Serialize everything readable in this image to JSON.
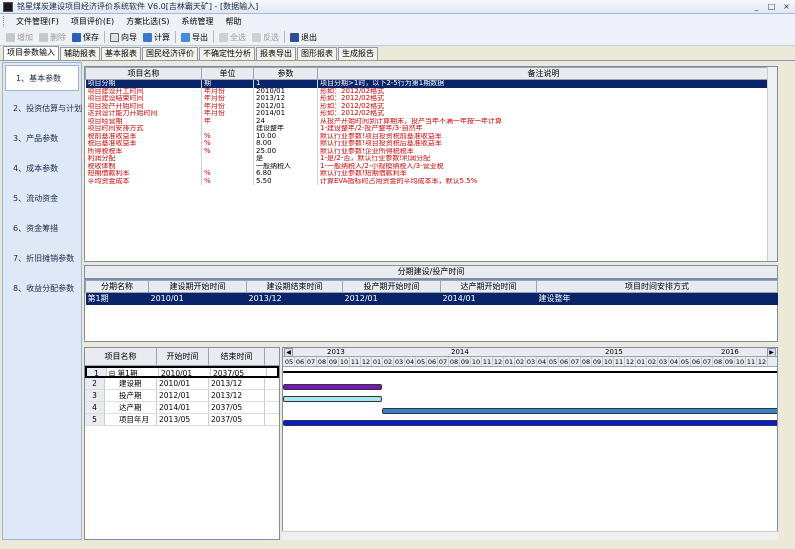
{
  "window": {
    "title": "铭星煤炭建设项目经济评价系统软件 V6.0[吉林霸天矿] - [数据输入]"
  },
  "menu": [
    "文件管理(F)",
    "项目评价(E)",
    "方案比选(S)",
    "系统管理",
    "帮助"
  ],
  "toolbar": [
    {
      "label": "增加",
      "enabled": false,
      "icon": "add-icon"
    },
    {
      "label": "删除",
      "enabled": false,
      "icon": "delete-icon"
    },
    {
      "label": "保存",
      "enabled": true,
      "icon": "save-icon"
    },
    {
      "label": "向导",
      "enabled": true,
      "icon": "wizard-icon"
    },
    {
      "label": "计算",
      "enabled": true,
      "icon": "calculate-icon"
    },
    {
      "label": "导出",
      "enabled": true,
      "icon": "export-icon"
    },
    {
      "label": "全选",
      "enabled": false,
      "icon": "select-all-icon"
    },
    {
      "label": "反选",
      "enabled": false,
      "icon": "invert-icon"
    },
    {
      "label": "退出",
      "enabled": true,
      "icon": "exit-icon"
    }
  ],
  "tabs": [
    "项目参数输入",
    "辅助报表",
    "基本报表",
    "国民经济评价",
    "不确定性分析",
    "报表导出",
    "图形报表",
    "生成报告"
  ],
  "sidebar": [
    "1、基本参数",
    "2、投资估算与计划",
    "3、产品参数",
    "4、成本参数",
    "5、流动资金",
    "6、资金筹措",
    "7、折旧摊销参数",
    "8、收益分配参数"
  ],
  "params_table": {
    "headers": [
      "项目名称",
      "单位",
      "参数",
      "备注说明"
    ],
    "rows": [
      [
        "项目分期",
        "期",
        "1",
        "项目分期>1时，以下2-5行为第1期数据"
      ],
      [
        "项目建设开工时间",
        "年月份",
        "2010/01",
        "形如：2012/02格式"
      ],
      [
        "项目建设结束时间",
        "年月份",
        "2013/12",
        "形如：2012/02格式"
      ],
      [
        "项目投产开始时间",
        "年月份",
        "2012/01",
        "形如：2012/02格式"
      ],
      [
        "达到设计能力开始时间",
        "年月份",
        "2014/01",
        "形如：2012/02格式"
      ],
      [
        "项目经营期",
        "年",
        "24",
        "从投产开始时间到计算期末，投产当年不满一年按一年计算"
      ],
      [
        "项目时间安排方式",
        "",
        "建设整年",
        "1-建设整年/2-投产整年/3-自然年"
      ],
      [
        "税前基准收益率",
        "%",
        "10.00",
        "默认行业参数!项目投资税前基准收益率"
      ],
      [
        "税后基准收益率",
        "%",
        "8.00",
        "默认行业参数!项目投资税后基准收益率"
      ],
      [
        "所得税税率",
        "%",
        "25.00",
        "默认行业参数!企业所得税税率"
      ],
      [
        "利润分配",
        "",
        "是",
        "1-是/2-否，默认行业参数!利润分配"
      ],
      [
        "税收体制",
        "",
        "一般纳税人",
        "1-一般纳税人/2-小规模纳税人/3-营业税"
      ],
      [
        "短期借款利率",
        "%",
        "6.80",
        "默认行业参数!短期借款利率"
      ],
      [
        "平均资金成本",
        "%",
        "5.50",
        "计算EVA指标时占用资金的平均成本率，默认5.5%"
      ]
    ]
  },
  "phase_section": {
    "title": "分期建设/投产时间",
    "headers": [
      "分期名称",
      "建设期开始时间",
      "建设期结束时间",
      "投产期开始时间",
      "达产期开始时间",
      "项目时间安排方式"
    ],
    "rows": [
      [
        "第1期",
        "2010/01",
        "2013/12",
        "2012/01",
        "2014/01",
        "建设整年"
      ]
    ]
  },
  "gantt": {
    "headers": [
      "项目名称",
      "开始时间",
      "结束时间"
    ],
    "rows": [
      {
        "num": "1",
        "name": "第1期",
        "start": "2010/01",
        "end": "2037/05"
      },
      {
        "num": "2",
        "name": "建设期",
        "start": "2010/01",
        "end": "2013/12"
      },
      {
        "num": "3",
        "name": "投产期",
        "start": "2012/01",
        "end": "2013/12"
      },
      {
        "num": "4",
        "name": "达产期",
        "start": "2014/01",
        "end": "2037/05"
      },
      {
        "num": "5",
        "name": "项目年月",
        "start": "2013/05",
        "end": "2037/05"
      }
    ],
    "years": [
      "2013",
      "2014",
      "2015",
      "2016"
    ],
    "months": [
      "05",
      "06",
      "07",
      "08",
      "09",
      "10",
      "11",
      "12",
      "01",
      "02",
      "03",
      "04",
      "05",
      "06",
      "07",
      "08",
      "09",
      "10",
      "11",
      "12",
      "01",
      "02",
      "03",
      "04",
      "05",
      "06",
      "07",
      "08",
      "09",
      "10",
      "11",
      "12",
      "01",
      "02",
      "03",
      "04",
      "05",
      "06",
      "07",
      "08",
      "09",
      "10",
      "11",
      "12"
    ],
    "bar_colors": {
      "phase": "#000000",
      "construction": "#7a14b8",
      "production": "#a8e6f0",
      "full": "#3a7fd0",
      "project": "#0a1ad0"
    }
  }
}
